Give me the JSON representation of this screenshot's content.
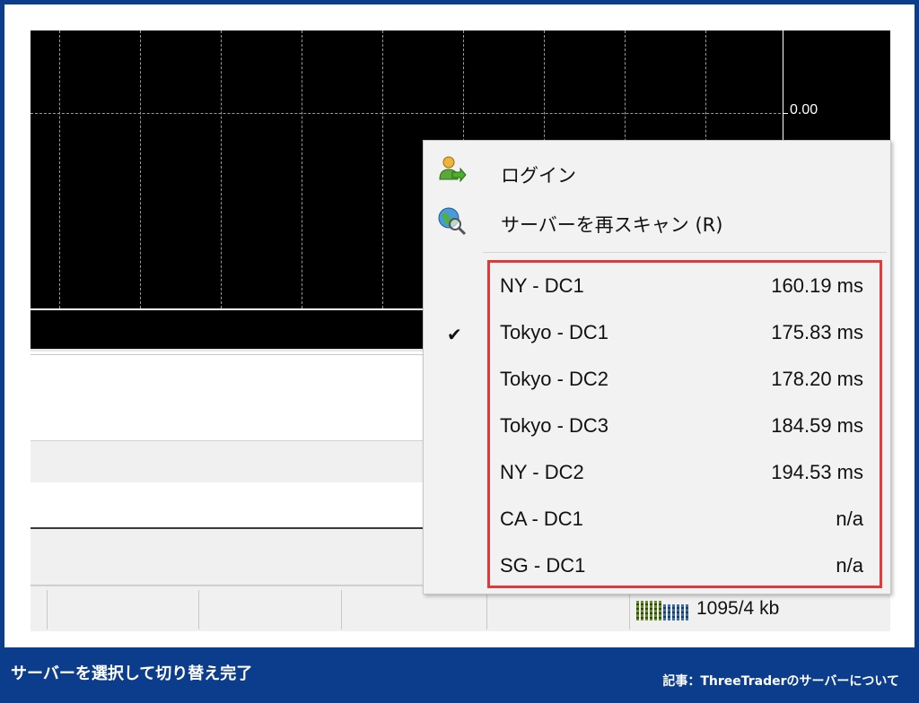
{
  "chart": {
    "price_label": "0.00",
    "background": "#000000",
    "grid_color": "#9a9a9a"
  },
  "status_bar": {
    "traffic": "1095/4 kb",
    "connection_icon": "connection-bars-icon"
  },
  "context_menu": {
    "items": [
      {
        "label": "ログイン",
        "icon": "login-user-icon"
      },
      {
        "label": "サーバーを再スキャン (R)",
        "icon": "rescan-globe-icon"
      }
    ],
    "servers": [
      {
        "name": "NY - DC1",
        "ping": "160.19 ms",
        "checked": false
      },
      {
        "name": "Tokyo - DC1",
        "ping": "175.83 ms",
        "checked": true
      },
      {
        "name": "Tokyo - DC2",
        "ping": "178.20 ms",
        "checked": false
      },
      {
        "name": "Tokyo - DC3",
        "ping": "184.59 ms",
        "checked": false
      },
      {
        "name": "NY - DC2",
        "ping": "194.53 ms",
        "checked": false
      },
      {
        "name": "CA - DC1",
        "ping": "n/a",
        "checked": false
      },
      {
        "name": "SG - DC1",
        "ping": "n/a",
        "checked": false
      }
    ],
    "check_mark": "✔",
    "highlight_color": "#e23a3a"
  },
  "footer": {
    "caption": "サーバーを選択して切り替え完了",
    "article_note": "記事：ThreeTraderのサーバーについて",
    "background": "#0c3d8c"
  }
}
